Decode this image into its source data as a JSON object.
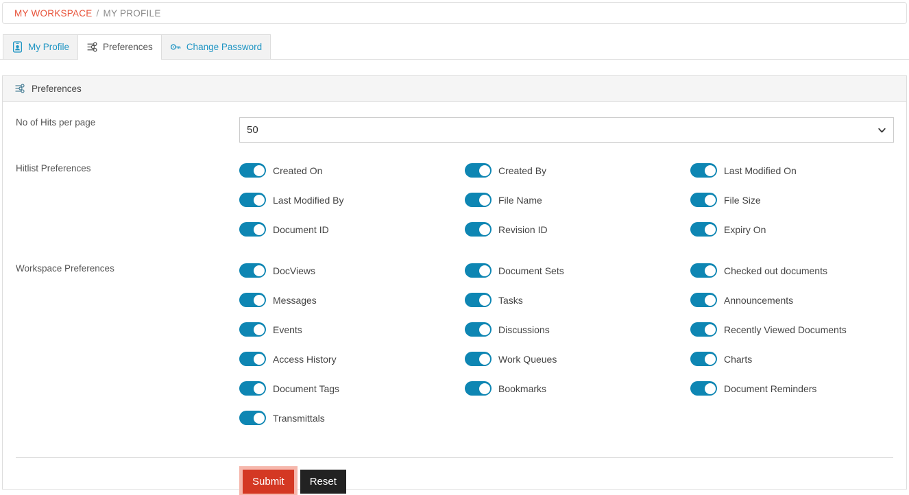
{
  "breadcrumb": {
    "root": "MY WORKSPACE",
    "separator": "/",
    "current": "MY PROFILE"
  },
  "tabs": [
    {
      "label": "My Profile",
      "icon": "id-card-icon",
      "active": false
    },
    {
      "label": "Preferences",
      "icon": "sliders-icon",
      "active": true
    },
    {
      "label": "Change Password",
      "icon": "key-icon",
      "active": false
    }
  ],
  "panel": {
    "title": "Preferences",
    "icon": "sliders-icon"
  },
  "hits_per_page": {
    "label": "No of Hits per page",
    "value": "50",
    "chevron": "chevron-down-icon"
  },
  "hitlist_preferences": {
    "label": "Hitlist Preferences",
    "items": [
      {
        "label": "Created On",
        "on": true
      },
      {
        "label": "Created By",
        "on": true
      },
      {
        "label": "Last Modified On",
        "on": true
      },
      {
        "label": "Last Modified By",
        "on": true
      },
      {
        "label": "File Name",
        "on": true
      },
      {
        "label": "File Size",
        "on": true
      },
      {
        "label": "Document ID",
        "on": true
      },
      {
        "label": "Revision ID",
        "on": true
      },
      {
        "label": "Expiry On",
        "on": true
      }
    ]
  },
  "workspace_preferences": {
    "label": "Workspace Preferences",
    "items": [
      {
        "label": "DocViews",
        "on": true
      },
      {
        "label": "Document Sets",
        "on": true
      },
      {
        "label": "Checked out documents",
        "on": true
      },
      {
        "label": "Messages",
        "on": true
      },
      {
        "label": "Tasks",
        "on": true
      },
      {
        "label": "Announcements",
        "on": true
      },
      {
        "label": "Events",
        "on": true
      },
      {
        "label": "Discussions",
        "on": true
      },
      {
        "label": "Recently Viewed Documents",
        "on": true
      },
      {
        "label": "Access History",
        "on": true
      },
      {
        "label": "Work Queues",
        "on": true
      },
      {
        "label": "Charts",
        "on": true
      },
      {
        "label": "Document Tags",
        "on": true
      },
      {
        "label": "Bookmarks",
        "on": true
      },
      {
        "label": "Document Reminders",
        "on": true
      },
      {
        "label": "Transmittals",
        "on": true
      }
    ]
  },
  "actions": {
    "submit_label": "Submit",
    "reset_label": "Reset"
  },
  "colors": {
    "toggle_on": "#0e86b3",
    "breadcrumb_link": "#e8533a",
    "tab_link": "#2196c4",
    "submit_bg": "#d43823",
    "submit_focus_ring": "#f6b7ac",
    "reset_bg": "#222222"
  }
}
